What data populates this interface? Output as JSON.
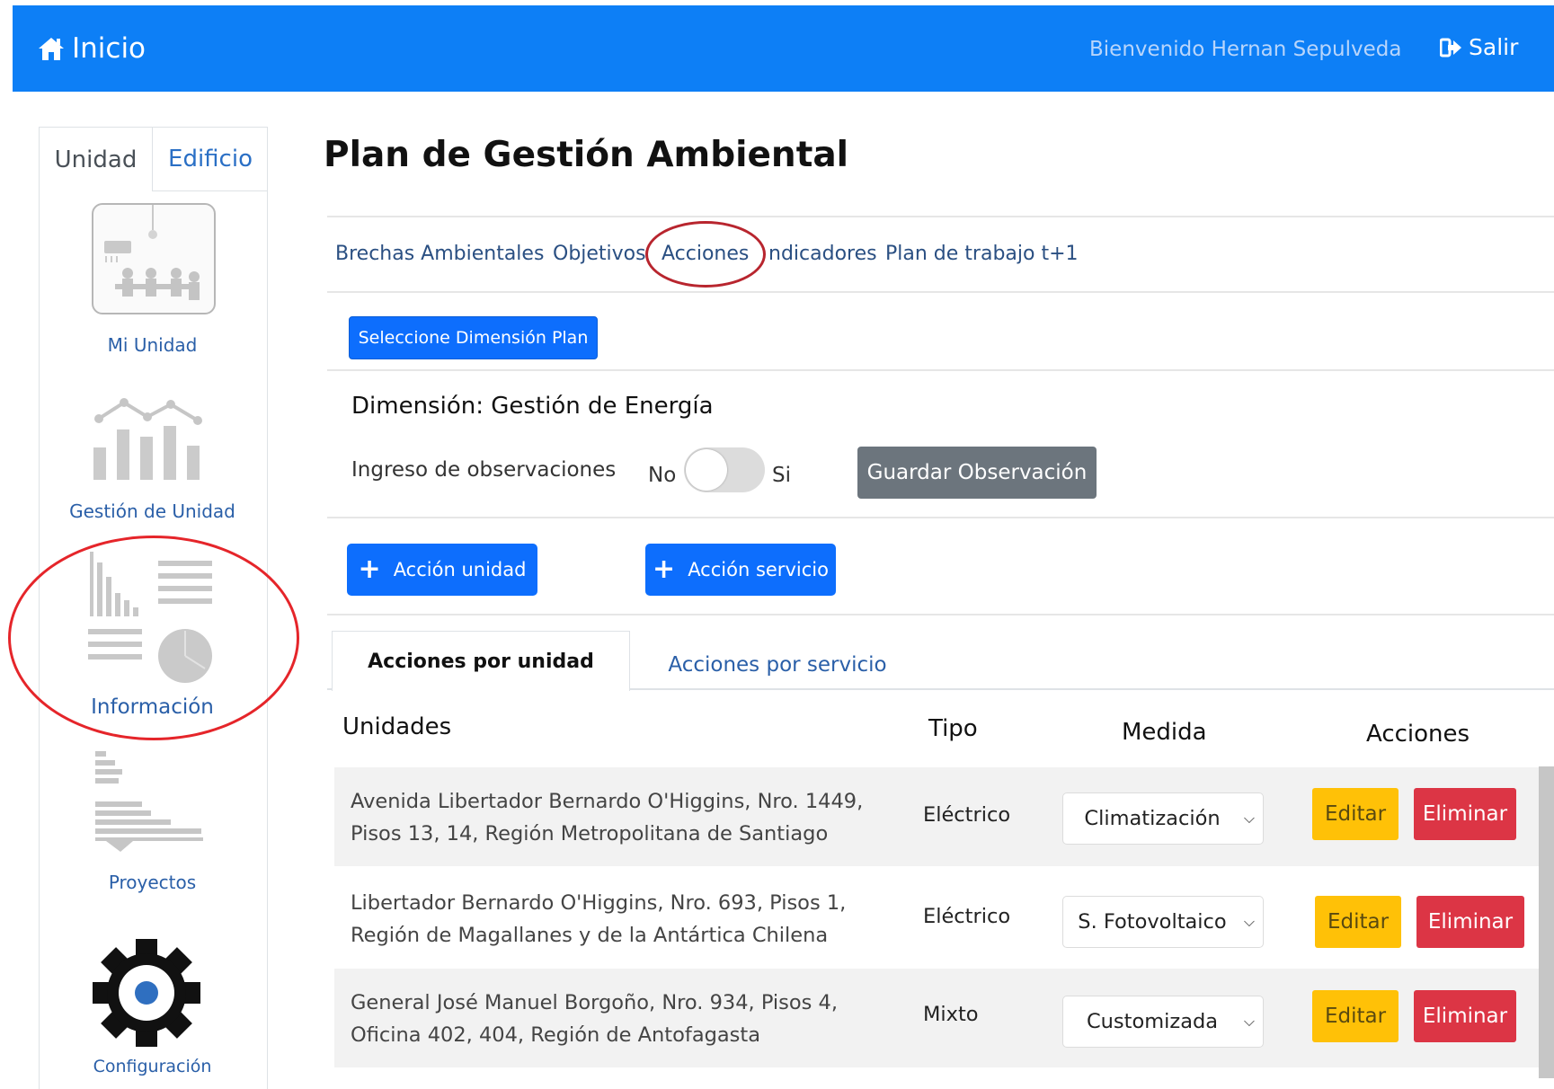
{
  "header": {
    "home_label": "Inicio",
    "welcome": "Bienvenido Hernan Sepulveda",
    "logout": "Salir",
    "bar_color": "#0d7ff6"
  },
  "sidebar": {
    "tabs": [
      {
        "label": "Unidad",
        "active": true
      },
      {
        "label": "Edificio",
        "active": false
      }
    ],
    "items": [
      {
        "label": "Mi Unidad",
        "icon": "meeting-room-icon"
      },
      {
        "label": "Gestión de Unidad",
        "icon": "bar-line-chart-icon"
      },
      {
        "label": "Información",
        "icon": "info-charts-icon"
      },
      {
        "label": "Proyectos",
        "icon": "gantt-chart-icon"
      },
      {
        "label": "Configuración",
        "icon": "gear-icon"
      }
    ]
  },
  "page": {
    "title": "Plan de Gestión Ambiental"
  },
  "nav": {
    "items": [
      {
        "label": "Brechas Ambientales"
      },
      {
        "label": "Objetivos"
      },
      {
        "label": "Acciones",
        "highlighted": true
      },
      {
        "label": "ndicadores"
      },
      {
        "label": "Plan de trabajo t+1"
      }
    ]
  },
  "dimension": {
    "select_button": "Seleccione Dimensión Plan",
    "label": "Dimensión: Gestión de Energía",
    "observations_label": "Ingreso de observaciones",
    "toggle_no": "No",
    "toggle_si": "Si",
    "toggle_on": false,
    "save_button": "Guardar Observación"
  },
  "actions": {
    "add_unit": "Acción unidad",
    "add_service": "Acción servicio"
  },
  "tabs": [
    {
      "label": "Acciones por unidad",
      "active": true
    },
    {
      "label": "Acciones por servicio",
      "active": false
    }
  ],
  "table": {
    "headers": {
      "unidades": "Unidades",
      "tipo": "Tipo",
      "medida": "Medida",
      "acciones": "Acciones"
    },
    "edit_label": "Editar",
    "delete_label": "Eliminar",
    "rows": [
      {
        "address_line1": "Avenida Libertador Bernardo O'Higgins, Nro. 1449,",
        "address_line2": "Pisos 13, 14, Región Metropolitana de Santiago",
        "tipo": "Eléctrico",
        "medida": "Climatización"
      },
      {
        "address_line1": "Libertador Bernardo O'Higgins, Nro. 693, Pisos 1,",
        "address_line2": "Región de Magallanes y de la Antártica Chilena",
        "tipo": "Eléctrico",
        "medida": "S. Fotovoltaico"
      },
      {
        "address_line1": "General José Manuel Borgoño, Nro. 934, Pisos 4,",
        "address_line2": "Oficina 402, 404, Región de Antofagasta",
        "tipo": "Mixto",
        "medida": "Customizada"
      }
    ]
  },
  "colors": {
    "primary": "#0d6efd",
    "secondary": "#6c757d",
    "warning": "#ffc107",
    "danger": "#dc3545",
    "annotation_red": "#e5252a"
  }
}
